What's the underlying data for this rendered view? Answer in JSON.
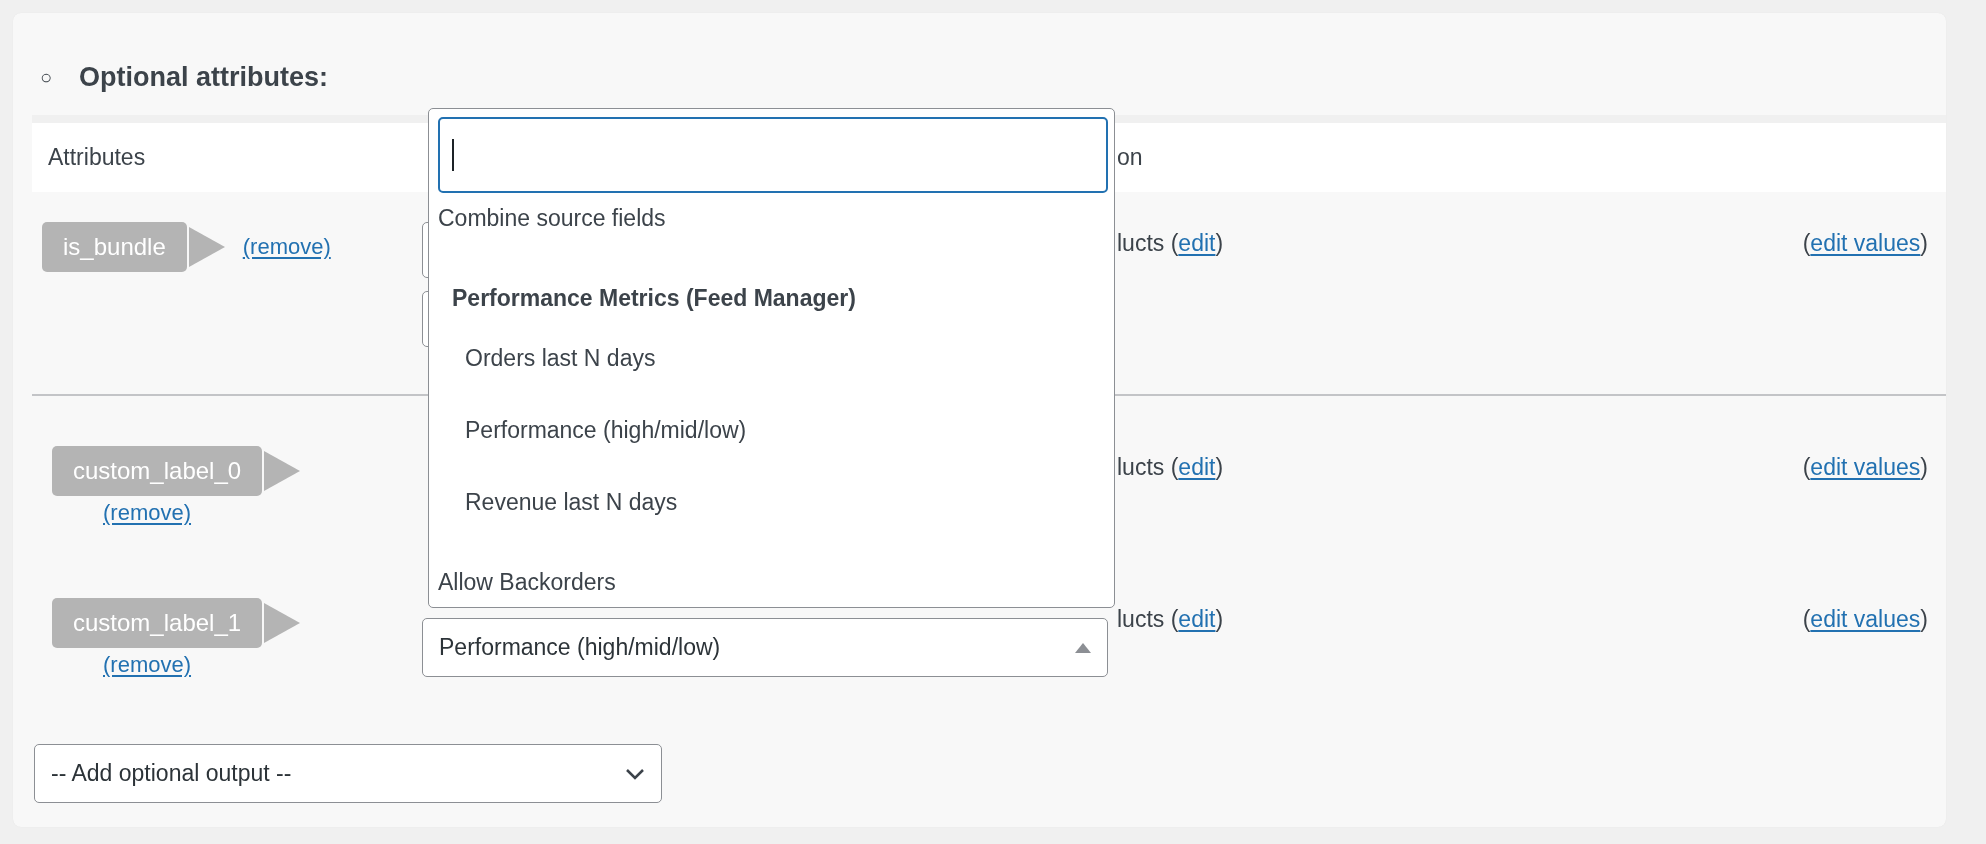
{
  "section": {
    "bullet": "○",
    "title": "Optional attributes:"
  },
  "table": {
    "header": {
      "column_1": "Attributes",
      "column_3": "on"
    },
    "rows": [
      {
        "kind": "inline",
        "attribute": "is_bundle",
        "remove": "(remove)",
        "source_fields": [
          {
            "kind": "select"
          },
          {
            "kind": "select"
          }
        ],
        "scope": {
          "before": "lucts (",
          "link": "edit",
          "after": ")"
        },
        "values": {
          "before": "(",
          "link": "edit values",
          "after": ")"
        }
      },
      {
        "kind": "stacked",
        "attribute": "custom_label_0",
        "remove": "(remove)",
        "scope": {
          "before": "lucts (",
          "link": "edit",
          "after": ")"
        },
        "values": {
          "before": "(",
          "link": "edit values",
          "after": ")"
        }
      },
      {
        "kind": "stacked",
        "attribute": "custom_label_1",
        "remove": "(remove)",
        "source_fields": [
          {
            "kind": "select",
            "value": "Performance (high/mid/low)",
            "open": true
          }
        ],
        "scope": {
          "before": "lucts (",
          "link": "edit",
          "after": ")"
        },
        "values": {
          "before": "(",
          "link": "edit values",
          "after": ")"
        }
      }
    ]
  },
  "dropdown": {
    "search": {
      "focused": true
    },
    "options": [
      {
        "kind": "option",
        "label": "Combine source fields"
      },
      {
        "kind": "group",
        "label": "Performance Metrics (Feed Manager)",
        "children": [
          {
            "kind": "option",
            "label": "Orders last N days"
          },
          {
            "kind": "option",
            "label": "Performance (high/mid/low)"
          },
          {
            "kind": "option",
            "label": "Revenue last N days"
          }
        ]
      },
      {
        "kind": "option",
        "label": "Allow Backorders"
      }
    ]
  },
  "add_output": {
    "value": "-- Add optional output --",
    "open": false
  }
}
